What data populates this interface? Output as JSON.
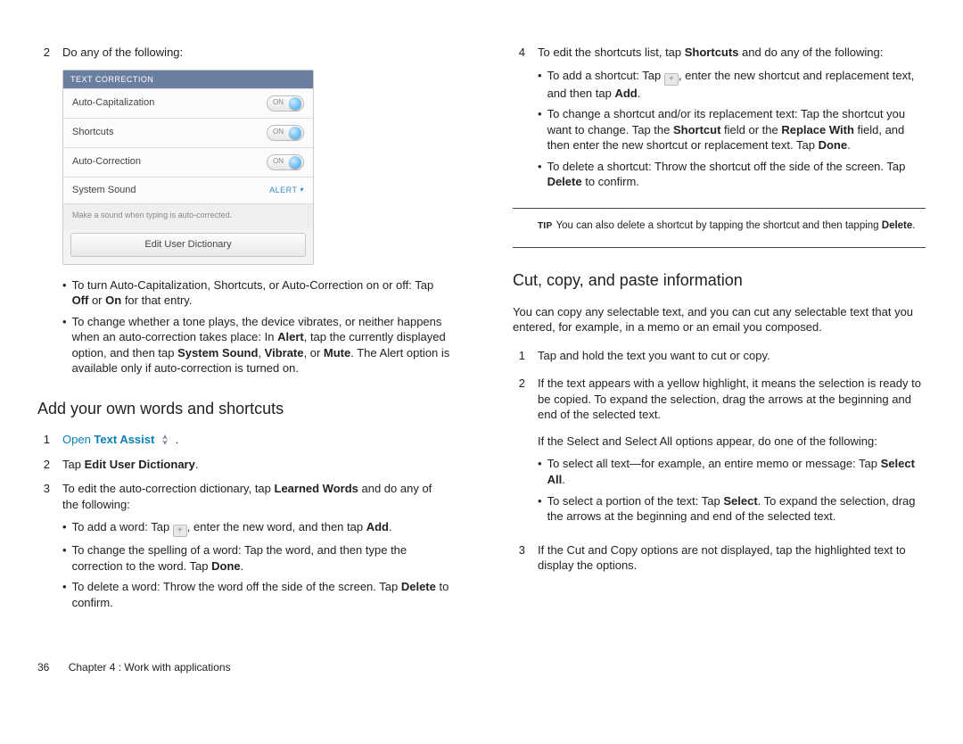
{
  "left": {
    "step2_num": "2",
    "step2_text": "Do any of the following:",
    "panel": {
      "header": "TEXT CORRECTION",
      "row1": "Auto-Capitalization",
      "row2": "Shortcuts",
      "row3": "Auto-Correction",
      "row4": "System Sound",
      "alert": "ALERT",
      "on": "ON",
      "hint": "Make a sound when typing is auto-corrected.",
      "button": "Edit User Dictionary"
    },
    "b1a": "To turn Auto-Capitalization, Shortcuts, or Auto-Correction on or off: Tap ",
    "b1_off": "Off",
    "b1_or": " or ",
    "b1_on": "On",
    "b1b": " for that entry.",
    "b2a": "To change whether a tone plays, the device vibrates, or neither happens when an auto-correction takes place: In ",
    "b2_alert": "Alert",
    "b2b": ", tap the currently displayed option, and then tap ",
    "b2_ss": "System Sound",
    "b2c": ", ",
    "b2_vib": "Vibrate",
    "b2d": ", or ",
    "b2_mute": "Mute",
    "b2e": ". The Alert option is available only if auto-correction is turned on.",
    "h2": "Add your own words and shortcuts",
    "s1_num": "1",
    "s1_open": "Open",
    "s1_ta": " Text Assist",
    "s1_dot": " .",
    "s2_num": "2",
    "s2a": "Tap ",
    "s2b": "Edit User Dictionary",
    "s2c": ".",
    "s3_num": "3",
    "s3a": "To edit the auto-correction dictionary, tap ",
    "s3b": "Learned Words",
    "s3c": " and do any of the following:",
    "s3_b1a": "To add a word: Tap ",
    "s3_b1b": ", enter the new word, and then tap ",
    "s3_b1c": "Add",
    "s3_b1d": ".",
    "s3_b2a": "To change the spelling of a word: Tap the word, and then type the correction to the word. Tap ",
    "s3_b2b": "Done",
    "s3_b2c": ".",
    "s3_b3a": "To delete a word: Throw the word off the side of the screen. Tap ",
    "s3_b3b": "Delete",
    "s3_b3c": " to confirm."
  },
  "right": {
    "s4_num": "4",
    "s4a": "To edit the shortcuts list, tap ",
    "s4b": "Shortcuts",
    "s4c": " and do any of the following:",
    "rb1a": "To add a shortcut: Tap ",
    "rb1b": ", enter the new shortcut and replacement text, and then tap ",
    "rb1c": "Add",
    "rb1d": ".",
    "rb2a": "To change a shortcut and/or its replacement text: Tap the shortcut you want to change. Tap the ",
    "rb2b": "Shortcut",
    "rb2c": " field or the ",
    "rb2d": "Replace With",
    "rb2e": " field, and then enter the new shortcut or replacement text. Tap ",
    "rb2f": "Done",
    "rb2g": ".",
    "rb3a": "To delete a shortcut: Throw the shortcut off the side of the screen. Tap ",
    "rb3b": "Delete",
    "rb3c": " to confirm.",
    "tip_label": "TIP",
    "tip_a": "You can also delete a shortcut by tapping the shortcut and then tapping ",
    "tip_b": "Delete",
    "tip_c": ".",
    "h2": "Cut, copy, and paste information",
    "intro": "You can copy any selectable text, and you can cut any selectable text that you entered, for example, in a memo or an email you composed.",
    "c1_num": "1",
    "c1": "Tap and hold the text you want to cut or copy.",
    "c2_num": "2",
    "c2": "If the text appears with a yellow highlight, it means the selection is ready to be copied. To expand the selection, drag the arrows at the beginning and end of the selected text.",
    "c2_sub": "If the Select and Select All options appear, do one of the following:",
    "cb1a": "To select all text—for example, an entire memo or message: Tap ",
    "cb1b": "Select All",
    "cb1c": ".",
    "cb2a": "To select a portion of the text: Tap ",
    "cb2b": "Select",
    "cb2c": ". To expand the selection, drag the arrows at the beginning and end of the selected text.",
    "c3_num": "3",
    "c3": "If the Cut and Copy options are not displayed, tap the highlighted text to display the options."
  },
  "footer": {
    "page": "36",
    "chapter": "Chapter 4 : Work with applications"
  }
}
